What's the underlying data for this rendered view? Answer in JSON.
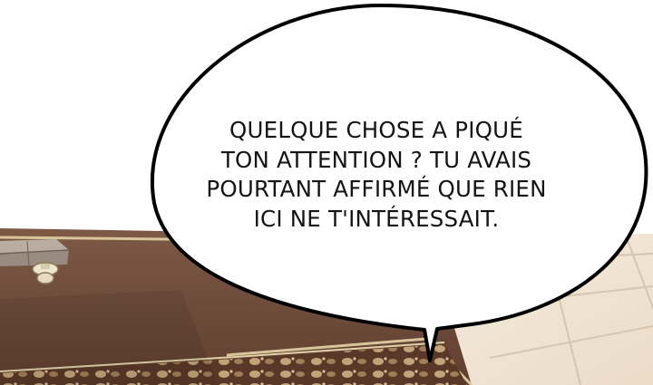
{
  "panel": {
    "speech_bubble": {
      "lines": [
        "QUELQUE CHOSE A PIQUÉ",
        "TON ATTENTION ? TU AVAIS",
        "POURTANT AFFIRMÉ QUE RIEN",
        "ICI NE T'INTÉRESSAIT."
      ]
    },
    "colors": {
      "background": "#ffffff",
      "floor_tile": "#f1e6d6",
      "floor_grout": "#d6c6b0",
      "desk_wood": "#74503c",
      "desk_border": "#d9c59c",
      "bubble_fill": "#ffffff",
      "bubble_outline": "#000000",
      "text": "#141414"
    }
  }
}
